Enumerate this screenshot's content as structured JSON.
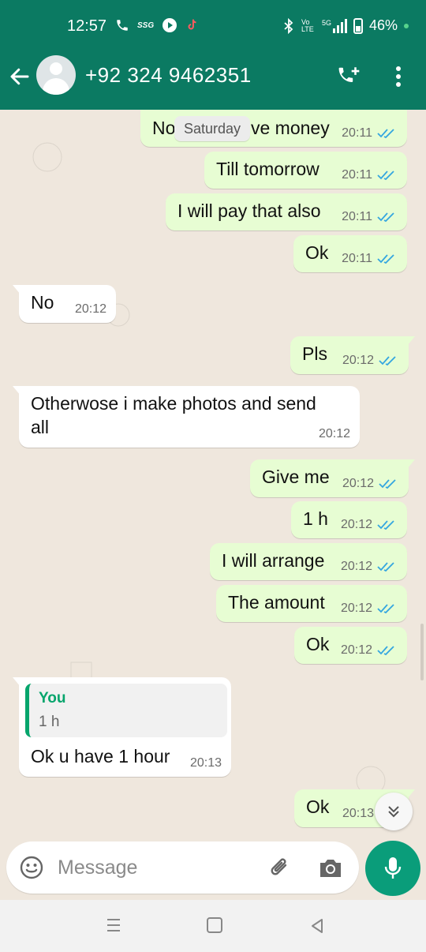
{
  "status_bar": {
    "time": "12:57",
    "battery": "46%",
    "icons": [
      "call-icon",
      "ssg-icon",
      "play-icon",
      "tiktok-icon",
      "bluetooth-icon",
      "volte-icon",
      "5g-signal-icon",
      "battery-icon"
    ],
    "net_labels": {
      "ssg": "SSG",
      "volte": "Vo LTE",
      "g5": "5G"
    }
  },
  "header": {
    "contact": "+92 324 9462351"
  },
  "chat": {
    "date_chip": "Saturday",
    "messages": [
      {
        "dir": "out",
        "text": "No money",
        "hidden_prefix": "No",
        "hidden_suffix": "ve money",
        "time": "20:11"
      },
      {
        "dir": "out",
        "text": "Till tomorrow",
        "time": "20:11"
      },
      {
        "dir": "out",
        "text": "I will pay that also",
        "time": "20:11"
      },
      {
        "dir": "out",
        "text": "Ok",
        "time": "20:11"
      },
      {
        "dir": "in",
        "text": "No",
        "time": "20:12"
      },
      {
        "dir": "out",
        "text": "Pls",
        "time": "20:12"
      },
      {
        "dir": "in",
        "text_line1": "Otherwose i make photos and send",
        "text_line2": "all",
        "time": "20:12"
      },
      {
        "dir": "out",
        "text": "Give me",
        "time": "20:12"
      },
      {
        "dir": "out",
        "text": "1 h",
        "time": "20:12"
      },
      {
        "dir": "out",
        "text": "I will arrange",
        "time": "20:12"
      },
      {
        "dir": "out",
        "text": "The amount",
        "time": "20:12"
      },
      {
        "dir": "out",
        "text": "Ok",
        "time": "20:12"
      },
      {
        "dir": "in",
        "quote_name": "You",
        "quote_text": "1 h",
        "text": "Ok u have 1 hour",
        "time": "20:13"
      },
      {
        "dir": "out",
        "text": "Ok",
        "time": "20:13"
      }
    ]
  },
  "composer": {
    "placeholder": "Message"
  },
  "colors": {
    "header": "#0b7a62",
    "outgoing_bubble": "#e7fdd3",
    "incoming_bubble": "#ffffff",
    "read_tick": "#34a6e0",
    "mic_button": "#0a9d7a"
  }
}
